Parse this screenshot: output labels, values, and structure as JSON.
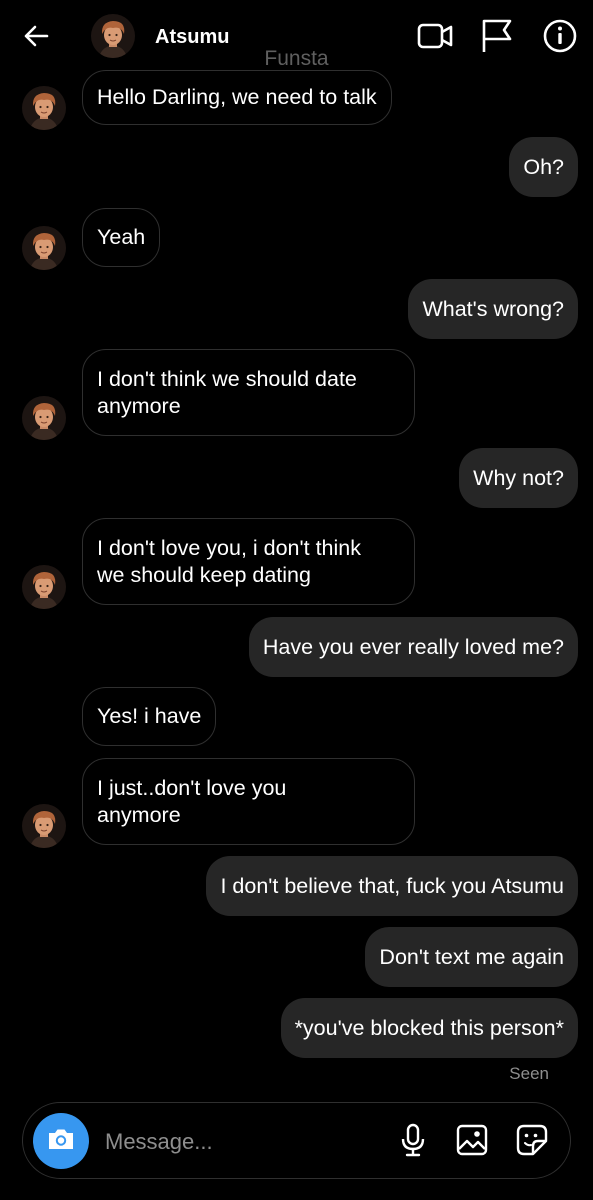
{
  "header": {
    "contact_name": "Atsumu",
    "subtitle": "Funsta",
    "icons": [
      "back-arrow-icon",
      "video-call-icon",
      "flag-icon",
      "info-icon"
    ]
  },
  "messages": [
    {
      "from": "them",
      "text": "Hello Darling, we need to talk",
      "avatar": true
    },
    {
      "from": "me",
      "text": "Oh?"
    },
    {
      "from": "them",
      "text": "Yeah",
      "avatar": true
    },
    {
      "from": "me",
      "text": "What's wrong?"
    },
    {
      "from": "them",
      "lines": [
        "I don't think we should date",
        "anymore"
      ],
      "avatar": true
    },
    {
      "from": "me",
      "text": "Why not?"
    },
    {
      "from": "them",
      "lines": [
        "I don't love you, i don't think",
        "we should keep dating"
      ],
      "avatar": true
    },
    {
      "from": "me",
      "text": "Have you ever really loved me?"
    },
    {
      "from": "them",
      "text": "Yes! i have",
      "avatar": false
    },
    {
      "from": "them",
      "lines": [
        "I just..don't love you",
        "anymore"
      ],
      "avatar": true
    },
    {
      "from": "me",
      "text": "I don't believe that, fuck you Atsumu"
    },
    {
      "from": "me",
      "text": "Don't text me again"
    },
    {
      "from": "me",
      "text": "*you've blocked this person*"
    }
  ],
  "status": {
    "seen_label": "Seen"
  },
  "composer": {
    "placeholder": "Message...",
    "icons": [
      "camera-icon",
      "microphone-icon",
      "gallery-icon",
      "sticker-icon"
    ]
  },
  "colors": {
    "background": "#000000",
    "outgoing_bubble": "#262626",
    "incoming_border": "#2f2f2f",
    "camera_button": "#3797f0",
    "muted_text": "#8e8e8e"
  }
}
